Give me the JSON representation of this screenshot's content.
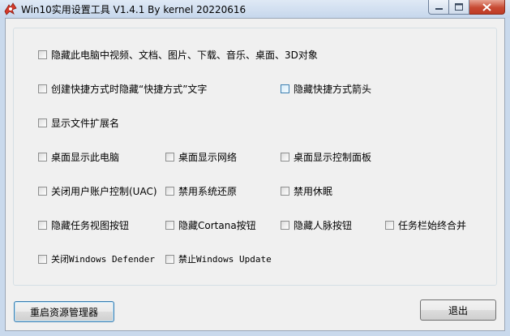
{
  "window": {
    "title": "Win10实用设置工具 V1.4.1 By kernel 20220616",
    "minimize_icon": "minimize-icon",
    "maximize_icon": "maximize-icon",
    "close_icon": "close-icon"
  },
  "options": {
    "hide_pc_folders": "隐藏此电脑中视频、文档、图片、下载、音乐、桌面、3D对象",
    "hide_shortcut_text": "创建快捷方式时隐藏“快捷方式”文字",
    "hide_shortcut_arrow": "隐藏快捷方式箭头",
    "show_extensions": "显示文件扩展名",
    "desktop_this_pc": "桌面显示此电脑",
    "desktop_network": "桌面显示网络",
    "desktop_control_panel": "桌面显示控制面板",
    "disable_uac": "关闭用户账户控制(UAC)",
    "disable_restore": "禁用系统还原",
    "disable_hibernate": "禁用休眠",
    "hide_task_view": "隐藏任务视图按钮",
    "hide_cortana": "隐藏Cortana按钮",
    "hide_people": "隐藏人脉按钮",
    "never_combine": "任务栏始终合并",
    "disable_defender": "关闭Windows Defender",
    "disable_update": "禁止Windows Update"
  },
  "buttons": {
    "restart_explorer": "重启资源管理器",
    "exit": "退出"
  },
  "colors": {
    "accent": "#3c7fb1",
    "close_red": "#c74a33"
  }
}
